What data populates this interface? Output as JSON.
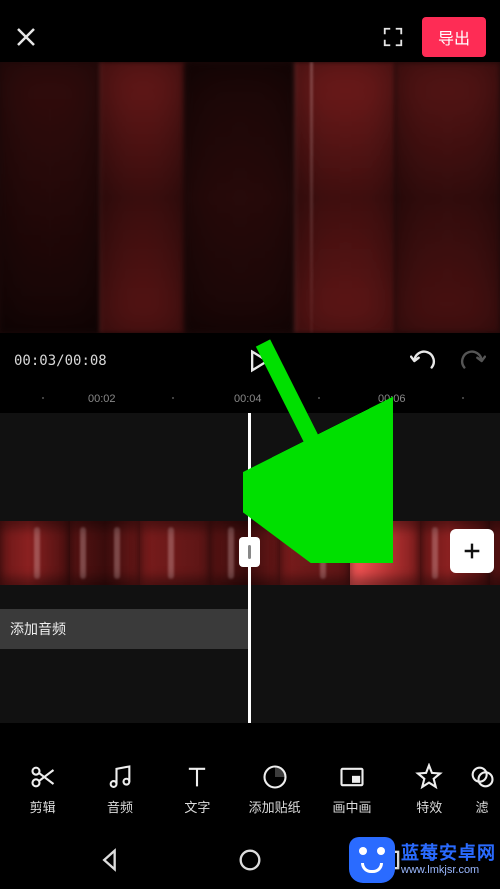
{
  "topbar": {
    "export_label": "导出"
  },
  "transport": {
    "current_time": "00:03",
    "total_time": "00:08"
  },
  "ruler": {
    "ticks": [
      "00:02",
      "00:04",
      "00:06"
    ]
  },
  "audio_track": {
    "add_audio_label": "添加音频"
  },
  "toolbar": {
    "items": [
      {
        "id": "cut",
        "label": "剪辑"
      },
      {
        "id": "audio",
        "label": "音频"
      },
      {
        "id": "text",
        "label": "文字"
      },
      {
        "id": "sticker",
        "label": "添加贴纸"
      },
      {
        "id": "pip",
        "label": "画中画"
      },
      {
        "id": "effect",
        "label": "特效"
      },
      {
        "id": "filter",
        "label": "滤"
      }
    ]
  },
  "watermark": {
    "line1": "蓝莓安卓网",
    "line2": "www.lmkjsr.com"
  },
  "colors": {
    "accent": "#fe2c55",
    "annotation": "#00e000"
  }
}
